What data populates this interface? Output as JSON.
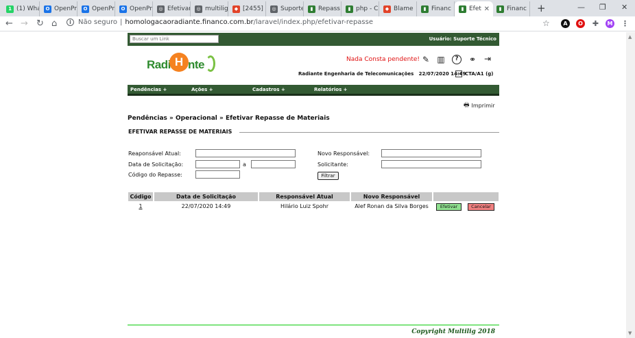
{
  "browser": {
    "tabs": [
      {
        "label": "(1) Wha",
        "color": "#25d366",
        "glyph": "1"
      },
      {
        "label": "OpenPr",
        "color": "#1a73e8",
        "glyph": "O"
      },
      {
        "label": "OpenPr",
        "color": "#1a73e8",
        "glyph": "O"
      },
      {
        "label": "OpenPr",
        "color": "#1a73e8",
        "glyph": "O"
      },
      {
        "label": "Efetivar",
        "color": "#5f6368",
        "glyph": "◎"
      },
      {
        "label": "multilig",
        "color": "#5f6368",
        "glyph": "◎"
      },
      {
        "label": "[2455]",
        "color": "#e24329",
        "glyph": "◆"
      },
      {
        "label": "Suporte",
        "color": "#5f6368",
        "glyph": "◎"
      },
      {
        "label": "Repass",
        "color": "#2e7d32",
        "glyph": "▮"
      },
      {
        "label": "php - C",
        "color": "#2e7d32",
        "glyph": "▮"
      },
      {
        "label": "Blame",
        "color": "#e24329",
        "glyph": "◆"
      },
      {
        "label": "Financ",
        "color": "#2e7d32",
        "glyph": "▮"
      },
      {
        "label": "Efet",
        "color": "#2e7d32",
        "glyph": "▮",
        "active": true
      },
      {
        "label": "Financ",
        "color": "#2e7d32",
        "glyph": "▮"
      }
    ],
    "new_tab": "+",
    "minimize": "—",
    "restore": "❐",
    "close": "✕",
    "back_icon": "←",
    "forward_icon": "→",
    "reload_icon": "↻",
    "home_icon": "⌂",
    "security_label": "Não seguro",
    "url_host": "homologacaoradiante.financo.com.br",
    "url_path": "/laravel/index.php/efetivar-repasse",
    "star_icon": "☆",
    "profile_initial": "M"
  },
  "topstrip": {
    "search_placeholder": "Buscar um Link",
    "user_label": "Usuário:",
    "user_name": "Suporte Técnico"
  },
  "header": {
    "logo_left": "Radi",
    "logo_mark": "H",
    "logo_right": "nte",
    "alert": "Nada Consta pendente!",
    "company": "Radiante Engenharia de Telecomunicações",
    "datetime": "22/07/2020 14:49",
    "unit": "CTA/A1 (g)"
  },
  "menu": {
    "items": [
      "Pendências +",
      "Ações +",
      "Cadastros +",
      "Relatórios +"
    ]
  },
  "print_label": "Imprimir",
  "breadcrumb": "Pendências » Operacional » Efetivar Repasse de Materiais",
  "section_title": "EFETIVAR REPASSE DE MATERIAIS",
  "filters": {
    "responsavel_atual": "Reaponsável Atual:",
    "data_solicitacao": "Data de Solicitação:",
    "date_separator": "a",
    "codigo_repasse": "Código do Repasse:",
    "novo_responsavel": "Novo Responsável:",
    "solicitante": "Solicitante:",
    "filter_button": "Filtrar"
  },
  "table": {
    "headers": [
      "Código",
      "Data de Solicitação",
      "Responsável Atual",
      "Novo Responsável",
      ""
    ],
    "rows": [
      {
        "codigo": "1",
        "data": "22/07/2020 14:49",
        "responsavel": "Hilário Luiz Spohr",
        "novo": "Alef Ronan da Silva Borges",
        "efetivar": "Efetivar",
        "cancelar": "Cancelar"
      }
    ]
  },
  "footer": {
    "copyright": "Copyright Multilig 2018"
  }
}
